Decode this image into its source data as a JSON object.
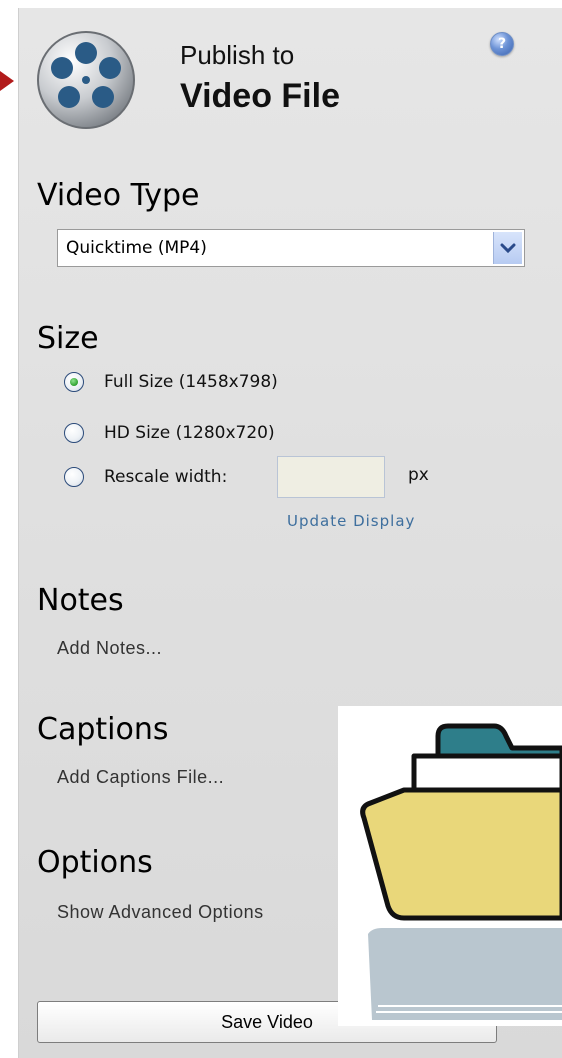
{
  "header": {
    "title_line1": "Publish to",
    "title_line2": "Video File",
    "help_symbol": "?"
  },
  "video_type": {
    "heading": "Video Type",
    "selected": "Quicktime (MP4)"
  },
  "size": {
    "heading": "Size",
    "options": [
      {
        "label": "Full Size (1458x798)",
        "checked": true
      },
      {
        "label": "HD Size (1280x720)",
        "checked": false
      },
      {
        "label": "Rescale width:",
        "checked": false
      }
    ],
    "rescale_value": "",
    "unit": "px",
    "update_link": "Update Display"
  },
  "notes": {
    "heading": "Notes",
    "link": "Add Notes..."
  },
  "captions": {
    "heading": "Captions",
    "link": "Add Captions File..."
  },
  "options": {
    "heading": "Options",
    "link": "Show Advanced Options"
  },
  "save_button": "Save Video",
  "colors": {
    "accent_arrow": "#b21b1b",
    "link": "#3e6f9e",
    "folder_front": "#e9d77a",
    "folder_back": "#2e7e8a"
  },
  "icons": [
    "film-reel-icon",
    "help-icon",
    "dropdown-arrow-icon",
    "folder-icon"
  ]
}
